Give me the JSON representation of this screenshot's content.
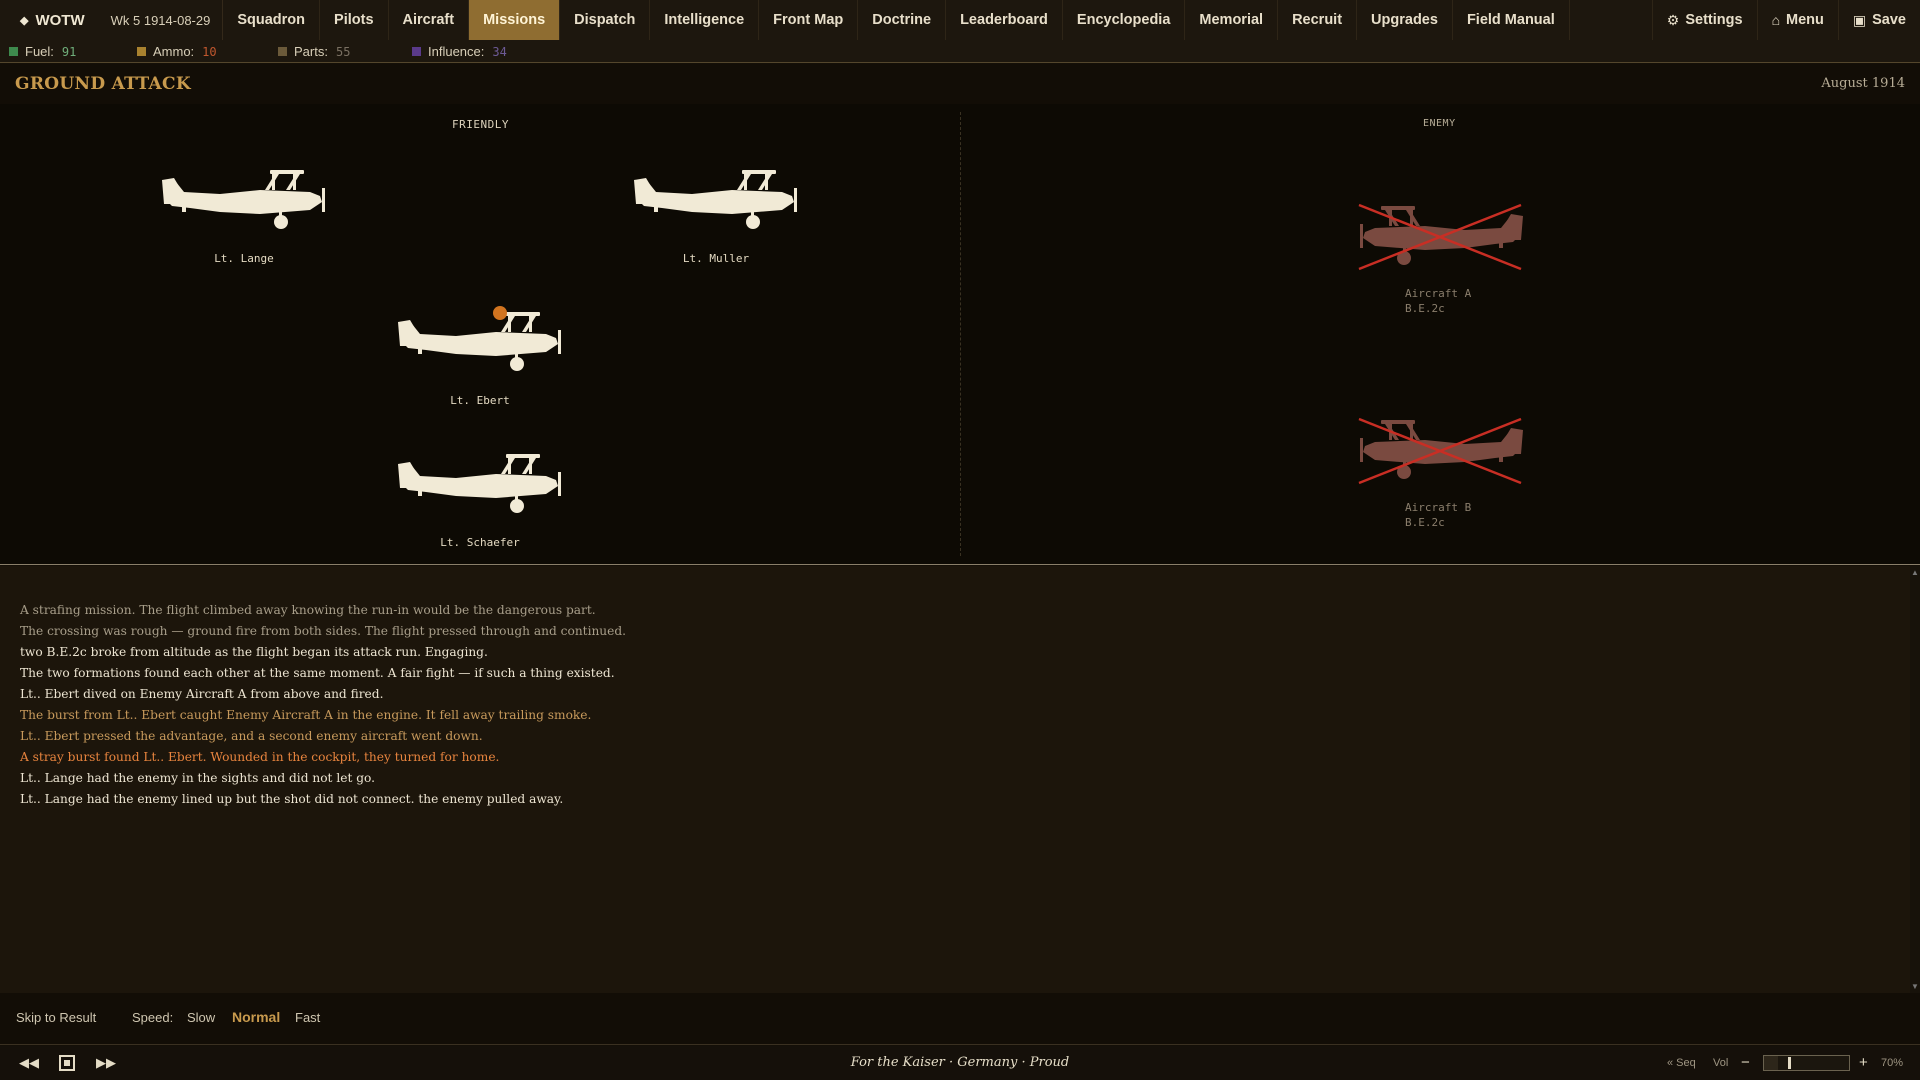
{
  "nav": {
    "brand": "WOTW",
    "week": "Wk 5  1914-08-29",
    "items": [
      "Squadron",
      "Pilots",
      "Aircraft",
      "Missions",
      "Dispatch",
      "Intelligence",
      "Front Map",
      "Doctrine",
      "Leaderboard",
      "Encyclopedia",
      "Memorial",
      "Recruit",
      "Upgrades",
      "Field Manual"
    ],
    "active": "Missions",
    "settings": "Settings",
    "menu": "Menu",
    "save": "Save"
  },
  "resources": {
    "fuel": {
      "label": "Fuel:",
      "value": "91",
      "color": "#3e8a4d",
      "value_color": "#6fae7a"
    },
    "ammo": {
      "label": "Ammo:",
      "value": "10",
      "color": "#a9822f",
      "value_color": "#c0572e"
    },
    "parts": {
      "label": "Parts:",
      "value": "55",
      "color": "#6b5a3a",
      "value_color": "#7a7062"
    },
    "influence": {
      "label": "Influence:",
      "value": "34",
      "color": "#5a3a8a",
      "value_color": "#6d5a96"
    }
  },
  "mission": {
    "title": "GROUND ATTACK",
    "date": "August 1914"
  },
  "battle": {
    "friendly_label": "FRIENDLY",
    "enemy_label": "ENEMY",
    "friendly": [
      {
        "name": "Lt. Lange",
        "wounded": false
      },
      {
        "name": "Lt. Muller",
        "wounded": false
      },
      {
        "name": "Lt. Ebert",
        "wounded": true
      },
      {
        "name": "Lt. Schaefer",
        "wounded": false
      }
    ],
    "enemy": [
      {
        "name": "Aircraft A",
        "type": "B.E.2c",
        "destroyed": true
      },
      {
        "name": "Aircraft B",
        "type": "B.E.2c",
        "destroyed": true
      }
    ]
  },
  "log": [
    {
      "text": "A strafing mission. The flight climbed away knowing the run-in would be the dangerous part.",
      "tone": "dim"
    },
    {
      "text": "The crossing was rough — ground fire from both sides. The flight pressed through and continued.",
      "tone": "dim"
    },
    {
      "text": "two B.E.2c broke from altitude as the flight began its attack run. Engaging.",
      "tone": "norm"
    },
    {
      "text": "The two formations found each other at the same moment. A fair fight — if such a thing existed.",
      "tone": "norm"
    },
    {
      "text": "Lt.. Ebert dived on Enemy Aircraft A from above and fired.",
      "tone": "norm"
    },
    {
      "text": "The burst from Lt.. Ebert caught Enemy Aircraft A in the engine. It fell away trailing smoke.",
      "tone": "warn"
    },
    {
      "text": "Lt.. Ebert pressed the advantage, and a second enemy aircraft went down.",
      "tone": "warn"
    },
    {
      "text": "A stray burst found Lt.. Ebert. Wounded in the cockpit, they turned for home.",
      "tone": "hit"
    },
    {
      "text": "Lt.. Lange had the enemy in the sights and did not let go.",
      "tone": "norm"
    },
    {
      "text": "Lt.. Lange had the enemy lined up but the shot did not connect. the enemy pulled away.",
      "tone": "norm"
    }
  ],
  "controls": {
    "skip": "Skip to Result",
    "speed_label": "Speed:",
    "speeds": [
      "Slow",
      "Normal",
      "Fast"
    ],
    "selected_speed": "Normal"
  },
  "footer": {
    "motto": "For the Kaiser · Germany · Proud",
    "seq": "« Seq",
    "vol_label": "Vol",
    "vol_minus": "−",
    "vol_plus": "+",
    "volume_percent": "70%",
    "volume_level": 0.7
  }
}
